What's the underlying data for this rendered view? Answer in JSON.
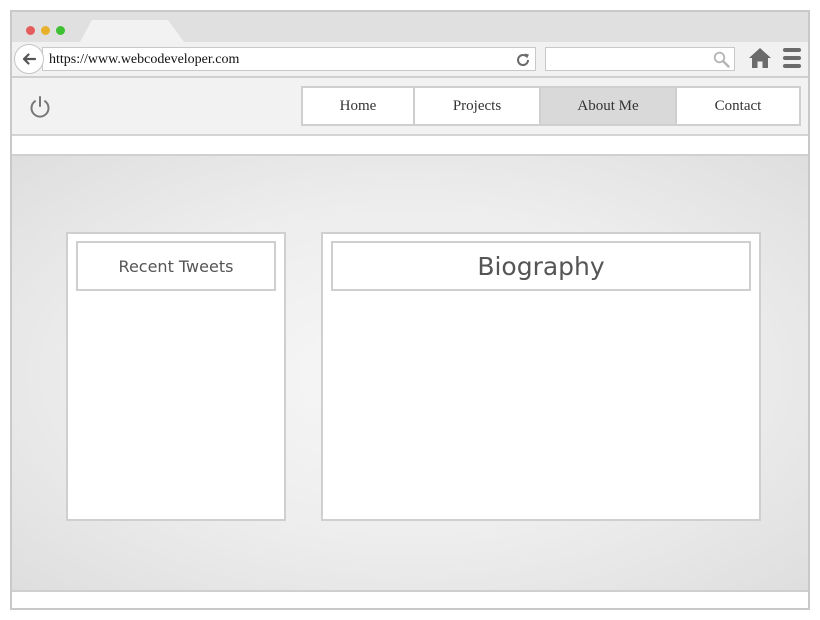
{
  "browser": {
    "url": "https://www.webcodeveloper.com",
    "search": {
      "value": "",
      "placeholder": ""
    },
    "traffic_light_colors": {
      "close": "#e55c5c",
      "minimize": "#e8b12d",
      "maximize": "#3ec032"
    }
  },
  "site": {
    "nav": {
      "items": [
        {
          "label": "Home"
        },
        {
          "label": "Projects"
        },
        {
          "label": "About Me",
          "active": true
        },
        {
          "label": "Contact"
        }
      ]
    },
    "panels": {
      "tweets_title": "Recent Tweets",
      "bio_title": "Biography"
    }
  },
  "colors": {
    "icon_gray": "#6b6b6b",
    "border_gray": "#cfcfcf",
    "active_nav": "#d9d9d9"
  }
}
